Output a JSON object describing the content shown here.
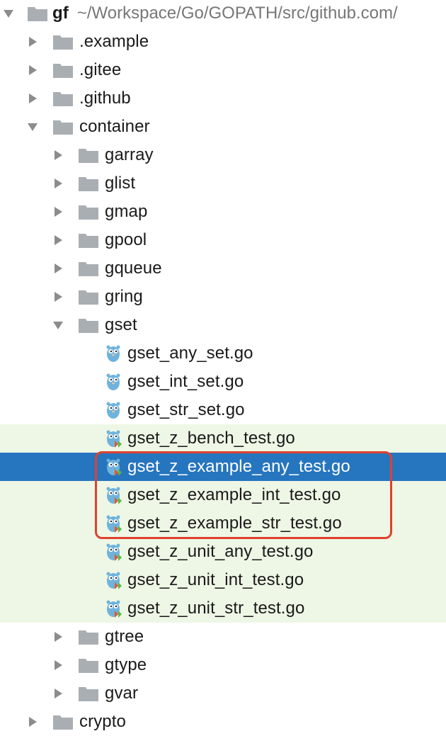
{
  "project_tree": {
    "root": {
      "name": "gf",
      "path": "~/Workspace/Go/GOPATH/src/github.com/"
    },
    "items": [
      {
        "label": ".example"
      },
      {
        "label": ".gitee"
      },
      {
        "label": ".github"
      },
      {
        "label": "container"
      },
      {
        "label": "garray"
      },
      {
        "label": "glist"
      },
      {
        "label": "gmap"
      },
      {
        "label": "gpool"
      },
      {
        "label": "gqueue"
      },
      {
        "label": "gring"
      },
      {
        "label": "gset"
      },
      {
        "label": "gset_any_set.go"
      },
      {
        "label": "gset_int_set.go"
      },
      {
        "label": "gset_str_set.go"
      },
      {
        "label": "gset_z_bench_test.go"
      },
      {
        "label": "gset_z_example_any_test.go"
      },
      {
        "label": "gset_z_example_int_test.go"
      },
      {
        "label": "gset_z_example_str_test.go"
      },
      {
        "label": "gset_z_unit_any_test.go"
      },
      {
        "label": "gset_z_unit_int_test.go"
      },
      {
        "label": "gset_z_unit_str_test.go"
      },
      {
        "label": "gtree"
      },
      {
        "label": "gtype"
      },
      {
        "label": "gvar"
      },
      {
        "label": "crypto"
      }
    ]
  },
  "colors": {
    "selection": "#2675bf",
    "test_row_background": "#eef7e5",
    "highlight_border": "#e0412d",
    "folder": "#a9aeb3"
  },
  "icons": {
    "folder": "folder-icon",
    "go_file": "gopher-icon",
    "expanded": "chevron-down-icon",
    "collapsed": "chevron-right-icon"
  }
}
